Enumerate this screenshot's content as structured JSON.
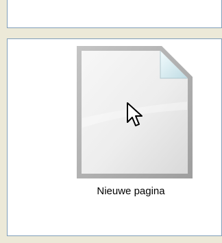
{
  "colors": {
    "window_background": "#ECE9D8",
    "panel_border": "#7F9DB9",
    "panel_background": "#FFFFFF",
    "page_frame": "#A8A8A8",
    "page_fold": "#DCEFF3"
  },
  "tile": {
    "label": "Nieuwe pagina",
    "icon": "blank-page-icon"
  },
  "cursor": {
    "icon": "arrow-cursor-icon"
  }
}
